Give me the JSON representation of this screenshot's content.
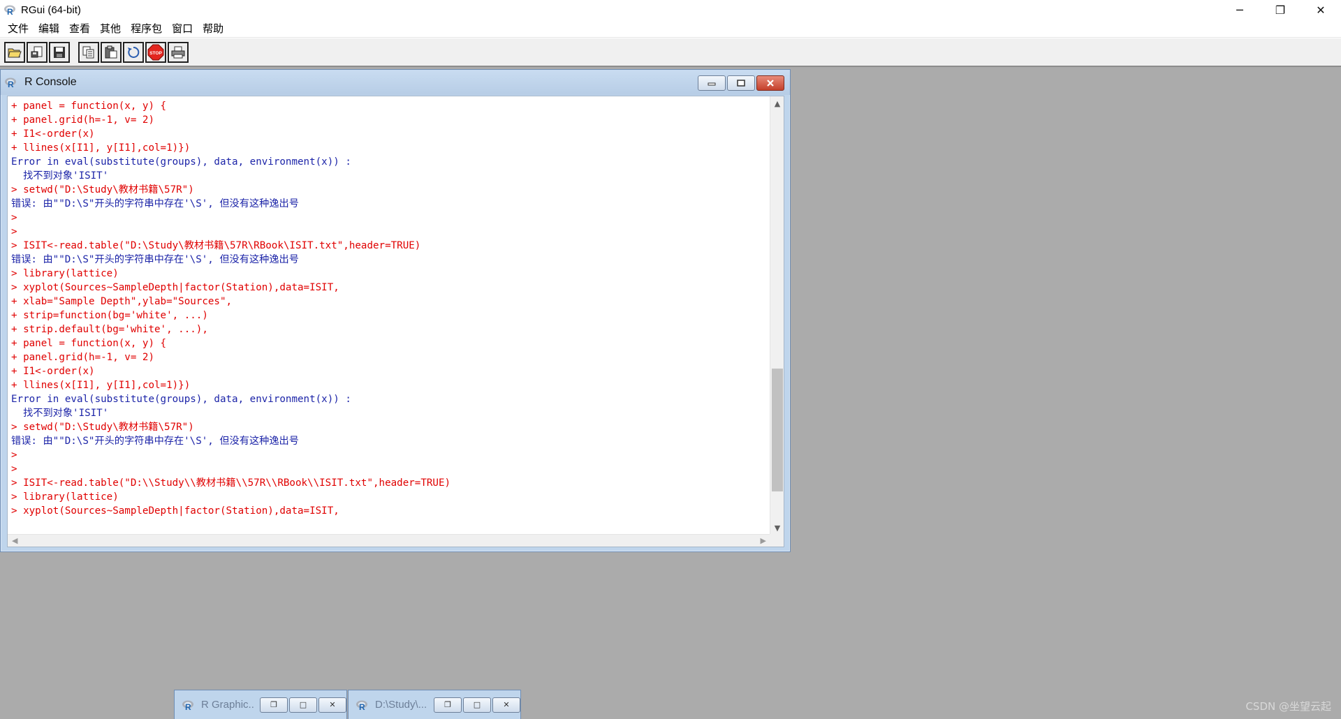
{
  "app": {
    "title": "RGui (64-bit)",
    "window_buttons": {
      "minimize": "─",
      "restore": "❐",
      "close": "✕"
    }
  },
  "menu": {
    "items": [
      "文件",
      "编辑",
      "查看",
      "其他",
      "程序包",
      "窗口",
      "帮助"
    ]
  },
  "toolbar": {
    "buttons": [
      {
        "name": "open-script-icon"
      },
      {
        "name": "load-workspace-icon"
      },
      {
        "name": "save-workspace-icon"
      },
      {
        "name": "copy-icon"
      },
      {
        "name": "paste-icon"
      },
      {
        "name": "copy-paste-icon"
      },
      {
        "name": "stop-icon",
        "label": "STOP"
      },
      {
        "name": "print-icon"
      }
    ]
  },
  "console": {
    "title": "R Console",
    "lines": [
      {
        "kind": "in",
        "text": "+ panel = function(x, y) {"
      },
      {
        "kind": "in",
        "text": "+ panel.grid(h=-1, v= 2)"
      },
      {
        "kind": "in",
        "text": "+ I1<-order(x)"
      },
      {
        "kind": "in",
        "text": "+ llines(x[I1], y[I1],col=1)})"
      },
      {
        "kind": "out",
        "text": "Error in eval(substitute(groups), data, environment(x)) :"
      },
      {
        "kind": "out",
        "text": "  找不到对象'ISIT'"
      },
      {
        "kind": "in",
        "text": "> setwd(\"D:\\Study\\教材书籍\\57R\")"
      },
      {
        "kind": "out",
        "text": "错误: 由\"\"D:\\S\"开头的字符串中存在'\\S', 但没有这种逸出号"
      },
      {
        "kind": "in",
        "text": ">"
      },
      {
        "kind": "in",
        "text": ">"
      },
      {
        "kind": "in",
        "text": "> ISIT<-read.table(\"D:\\Study\\教材书籍\\57R\\RBook\\ISIT.txt\",header=TRUE)"
      },
      {
        "kind": "out",
        "text": "错误: 由\"\"D:\\S\"开头的字符串中存在'\\S', 但没有这种逸出号"
      },
      {
        "kind": "in",
        "text": "> library(lattice)"
      },
      {
        "kind": "in",
        "text": "> xyplot(Sources~SampleDepth|factor(Station),data=ISIT,"
      },
      {
        "kind": "in",
        "text": "+ xlab=\"Sample Depth\",ylab=\"Sources\","
      },
      {
        "kind": "in",
        "text": "+ strip=function(bg='white', ...)"
      },
      {
        "kind": "in",
        "text": "+ strip.default(bg='white', ...),"
      },
      {
        "kind": "in",
        "text": "+ panel = function(x, y) {"
      },
      {
        "kind": "in",
        "text": "+ panel.grid(h=-1, v= 2)"
      },
      {
        "kind": "in",
        "text": "+ I1<-order(x)"
      },
      {
        "kind": "in",
        "text": "+ llines(x[I1], y[I1],col=1)})"
      },
      {
        "kind": "out",
        "text": "Error in eval(substitute(groups), data, environment(x)) :"
      },
      {
        "kind": "out",
        "text": "  找不到对象'ISIT'"
      },
      {
        "kind": "in",
        "text": "> setwd(\"D:\\Study\\教材书籍\\57R\")"
      },
      {
        "kind": "out",
        "text": "错误: 由\"\"D:\\S\"开头的字符串中存在'\\S', 但没有这种逸出号"
      },
      {
        "kind": "in",
        "text": ">"
      },
      {
        "kind": "in",
        "text": ">"
      },
      {
        "kind": "in",
        "text": "> ISIT<-read.table(\"D:\\\\Study\\\\教材书籍\\\\57R\\\\RBook\\\\ISIT.txt\",header=TRUE)"
      },
      {
        "kind": "in",
        "text": "> library(lattice)"
      },
      {
        "kind": "in",
        "text": "> xyplot(Sources~SampleDepth|factor(Station),data=ISIT,"
      }
    ]
  },
  "minimized_windows": [
    {
      "title": "R Graphic..."
    },
    {
      "title": "D:\\Study\\..."
    }
  ],
  "watermark": "CSDN @坐望云起",
  "colors": {
    "input_text": "#e00000",
    "output_text": "#1c24a8",
    "mdi_background": "#ababab",
    "child_frame": "#bfd5ec"
  }
}
